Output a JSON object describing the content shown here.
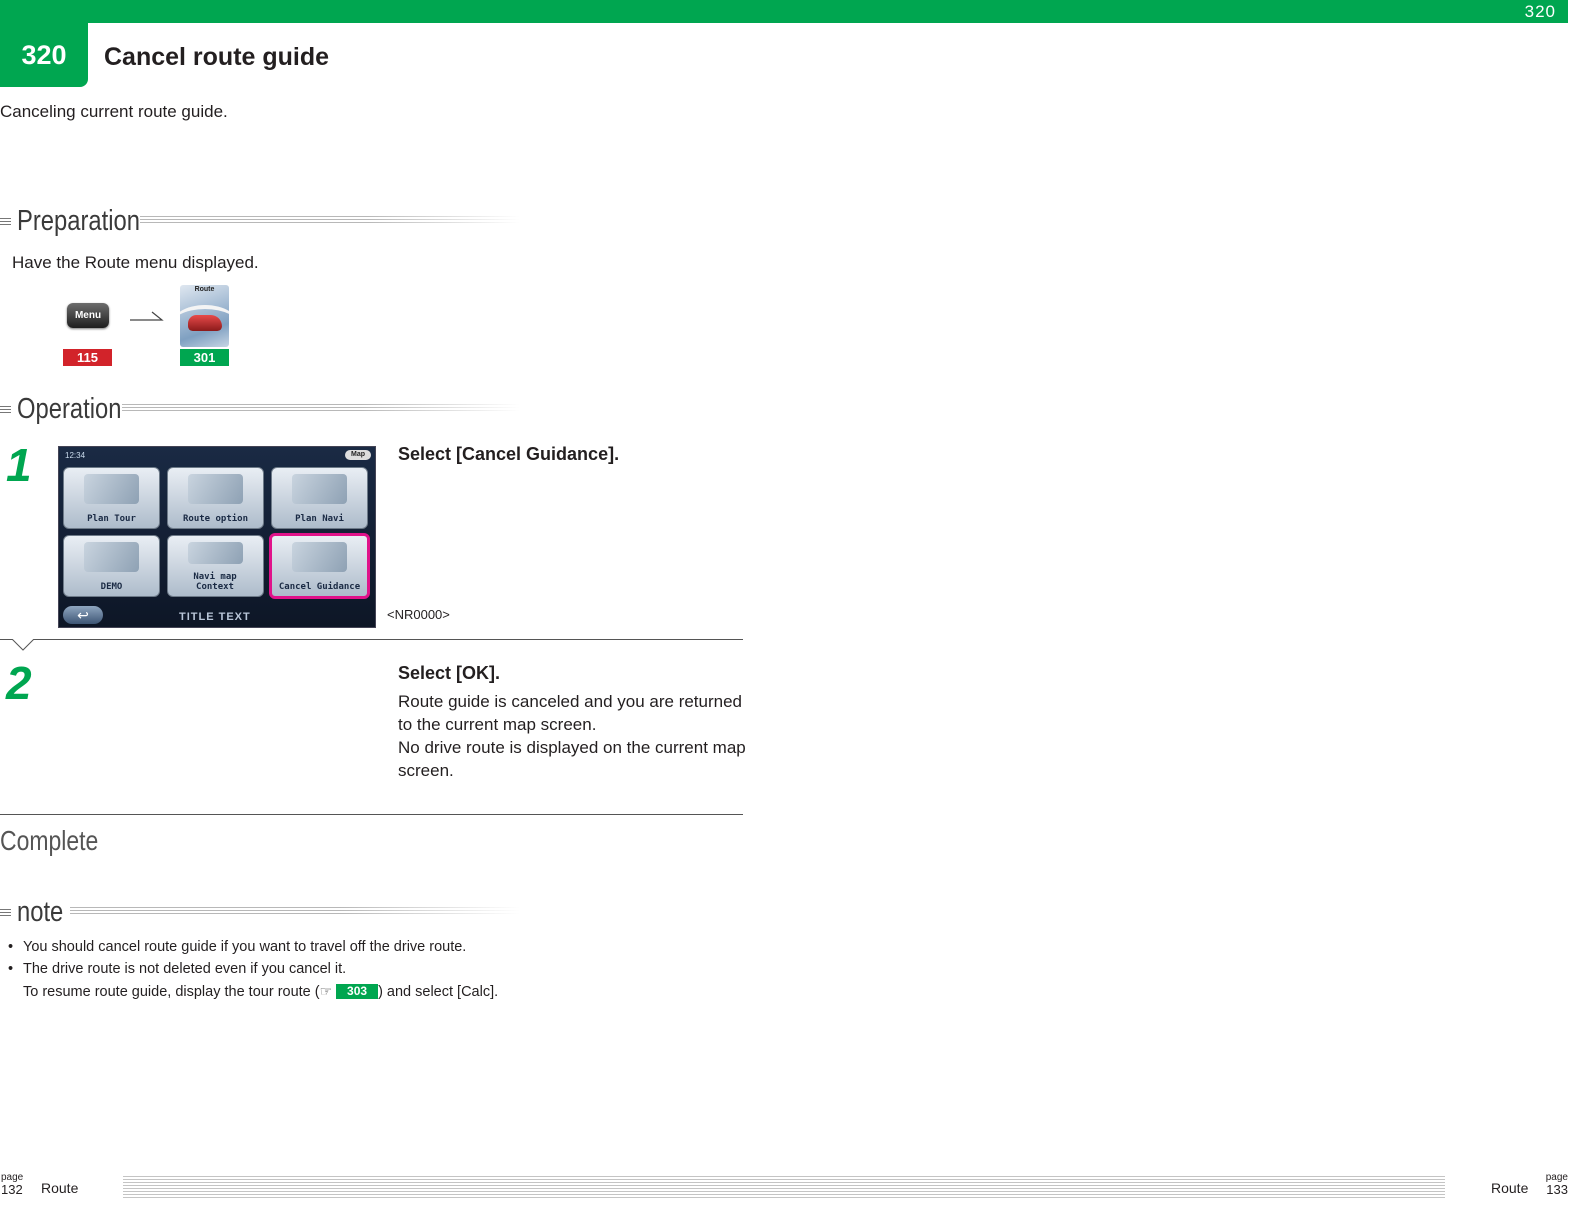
{
  "header": {
    "section_number": "320",
    "corner_number": "320",
    "title": "Cancel route guide",
    "intro": "Canceling current route guide."
  },
  "preparation": {
    "heading": "Preparation",
    "text": "Have the Route menu displayed.",
    "menu_button_label": "Menu",
    "route_icon_label": "Route",
    "ref_menu": "115",
    "ref_route": "301"
  },
  "operation": {
    "heading": "Operation",
    "steps": [
      {
        "number": "1",
        "title": "Select [Cancel Guidance].",
        "screen_id": "<NR0000>"
      },
      {
        "number": "2",
        "title": "Select [OK].",
        "body": [
          "Route guide is canceled and you are returned to the current map screen.",
          "No drive route is displayed on the current map screen."
        ]
      }
    ]
  },
  "screenshot": {
    "clock": "12:34",
    "map_button": "Map",
    "tiles": [
      {
        "label": "Plan Tour"
      },
      {
        "label": "Route option"
      },
      {
        "label": "Plan Navi"
      },
      {
        "label": "DEMO"
      },
      {
        "label": "Navi map Context"
      },
      {
        "label": "Cancel Guidance",
        "highlighted": true
      }
    ],
    "title_text": "TITLE TEXT"
  },
  "complete_label": "Complete",
  "note": {
    "heading": "note",
    "items": [
      "You should cancel route guide if you want to travel off the drive route.",
      "The drive route is not deleted even if you cancel it."
    ],
    "resume_prefix": "To resume route guide, display the tour route (",
    "resume_ref": "303",
    "resume_suffix": ") and select [Calc]."
  },
  "footer": {
    "page_word": "page",
    "left_page": "132",
    "right_page": "133",
    "left_section": "Route",
    "right_section": "Route"
  },
  "colors": {
    "brand_green": "#00a650",
    "ref_red": "#d2232a",
    "highlight_magenta": "#e0128a"
  }
}
